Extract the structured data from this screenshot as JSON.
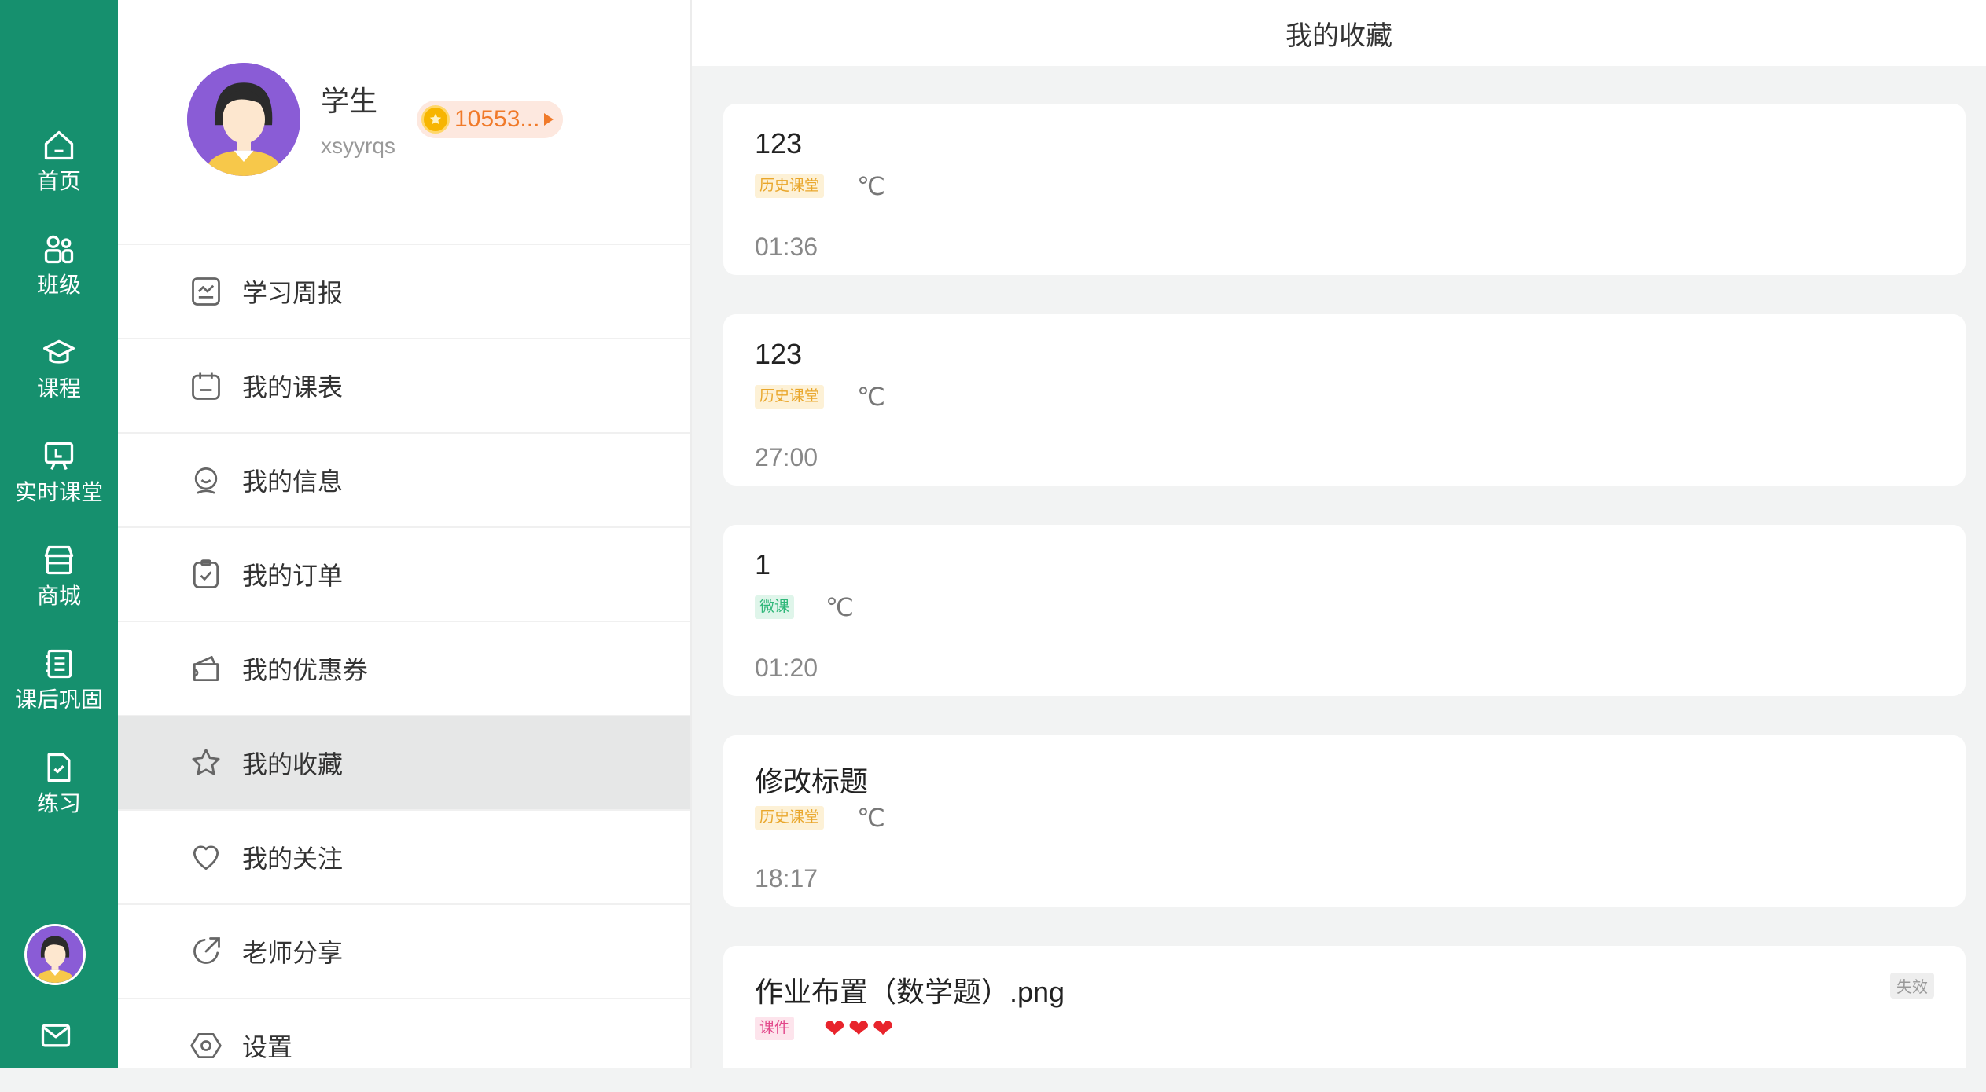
{
  "nav": {
    "items": [
      {
        "label": "首页",
        "icon": "home-icon"
      },
      {
        "label": "班级",
        "icon": "class-icon"
      },
      {
        "label": "课程",
        "icon": "graduation-cap-icon"
      },
      {
        "label": "实时课堂",
        "icon": "live-classroom-icon"
      },
      {
        "label": "商城",
        "icon": "store-icon"
      },
      {
        "label": "课后巩固",
        "icon": "notebook-icon"
      },
      {
        "label": "练习",
        "icon": "practice-icon"
      }
    ],
    "bottom_icons": [
      "avatar",
      "mail-icon"
    ]
  },
  "profile": {
    "name": "学生",
    "username": "xsyyrqs",
    "coins": "10553..."
  },
  "menu": {
    "items": [
      {
        "label": "学习周报",
        "icon": "weekly-report-icon"
      },
      {
        "label": "我的课表",
        "icon": "calendar-icon"
      },
      {
        "label": "我的信息",
        "icon": "user-info-icon"
      },
      {
        "label": "我的订单",
        "icon": "order-icon"
      },
      {
        "label": "我的优惠券",
        "icon": "coupon-icon"
      },
      {
        "label": "我的收藏",
        "icon": "star-icon",
        "active": true
      },
      {
        "label": "我的关注",
        "icon": "heart-icon"
      },
      {
        "label": "老师分享",
        "icon": "share-icon"
      },
      {
        "label": "设置",
        "icon": "settings-icon"
      }
    ]
  },
  "content": {
    "title": "我的收藏",
    "favorites": [
      {
        "title": "123",
        "tag": "历史课堂",
        "unit": "℃",
        "time": "01:36"
      },
      {
        "title": "123",
        "tag": "历史课堂",
        "unit": "℃",
        "time": "27:00"
      },
      {
        "title": "1",
        "tag": "微课",
        "unit": "℃",
        "time": "01:20"
      },
      {
        "title": "修改标题",
        "tag": "历史课堂",
        "unit": "℃",
        "time": "18:17"
      },
      {
        "title": "作业布置（数学题）.png",
        "tag": "课件",
        "hearts": "❤❤❤",
        "status": "失效"
      }
    ]
  },
  "colors": {
    "rail": "#16906e",
    "tag_history": "#e9a62a",
    "tag_micro": "#2fb779",
    "tag_courseware": "#e2478a",
    "coin": "#f07a2a"
  }
}
